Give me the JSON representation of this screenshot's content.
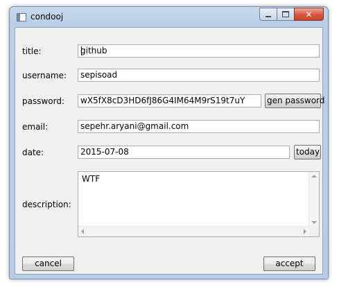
{
  "window": {
    "title": "condooj",
    "close_symbol": "✕"
  },
  "form": {
    "title_label": "title:",
    "title_value": "github",
    "username_label": "username:",
    "username_value": "sepisoad",
    "password_label": "password:",
    "password_value": "wX5fX8cD3HD6fJ86G4IM64M9rS19t7uY",
    "gen_password_button": "gen password",
    "email_label": "email:",
    "email_value": "sepehr.aryani@gmail.com",
    "date_label": "date:",
    "date_value": "2015-07-08",
    "today_button": "today",
    "description_label": "description:",
    "description_value": "WTF"
  },
  "footer": {
    "cancel_button": "cancel",
    "accept_button": "accept"
  },
  "colors": {
    "titlebar": "#b9cfe8",
    "close_button": "#d9553d",
    "client_bg": "#f0f0f0"
  }
}
